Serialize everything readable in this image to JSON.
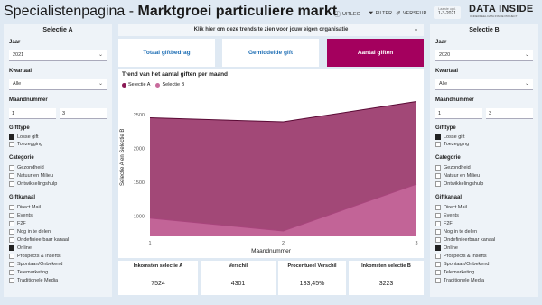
{
  "header": {
    "title_prefix": "Specialistenpagina - ",
    "title_bold": "Marktgroei particuliere markt",
    "buttons": [
      {
        "label": "UITLEG",
        "icon": "info-icon",
        "glyph": "ⓘ"
      },
      {
        "label": "FILTER",
        "icon": "filter-icon",
        "glyph": "⏷"
      },
      {
        "label": "VERSEUR",
        "icon": "eraser-icon",
        "glyph": "✐"
      }
    ],
    "update_label": "Laatste upd.",
    "update_value": "1-3-2021",
    "logo": "DATA INSIDE",
    "logo_sub": "ONDERDEEL DATA INSIDE PROJECT"
  },
  "panel_a": {
    "title": "Selectie A",
    "jaar_label": "Jaar",
    "jaar_value": "2021",
    "kwartaal_label": "Kwartaal",
    "kwartaal_value": "Alle",
    "maand_label": "Maandnummer",
    "maand_from": "1",
    "maand_to": "3",
    "gifttype_label": "Gifttype",
    "gifttype": [
      {
        "label": "Losse gift",
        "checked": true
      },
      {
        "label": "Toezegging",
        "checked": false
      }
    ],
    "categorie_label": "Categorie",
    "categorie": [
      {
        "label": "Gezondheid",
        "checked": false
      },
      {
        "label": "Natuur en Milieu",
        "checked": false
      },
      {
        "label": "Ontwikkelingshulp",
        "checked": false
      }
    ],
    "giftkanaal_label": "Giftkanaal",
    "giftkanaal": [
      {
        "label": "Direct Mail",
        "checked": false
      },
      {
        "label": "Events",
        "checked": false
      },
      {
        "label": "F2F",
        "checked": false
      },
      {
        "label": "Nog in te delen",
        "checked": false
      },
      {
        "label": "Ondefinieerbaar kanaal",
        "checked": false
      },
      {
        "label": "Online",
        "checked": true
      },
      {
        "label": "Prospects & Inserts",
        "checked": false
      },
      {
        "label": "Spontaan/Onbekend",
        "checked": false
      },
      {
        "label": "Telemarketing",
        "checked": false
      },
      {
        "label": "Traditionele Media",
        "checked": false
      }
    ]
  },
  "panel_b": {
    "title": "Selectie B",
    "jaar_label": "Jaar",
    "jaar_value": "2020",
    "kwartaal_label": "Kwartaal",
    "kwartaal_value": "Alle",
    "maand_label": "Maandnummer",
    "maand_from": "1",
    "maand_to": "3",
    "gifttype_label": "Gifttype",
    "gifttype": [
      {
        "label": "Losse gift",
        "checked": true
      },
      {
        "label": "Toezegging",
        "checked": false
      }
    ],
    "categorie_label": "Categorie",
    "categorie": [
      {
        "label": "Gezondheid",
        "checked": false
      },
      {
        "label": "Natuur en Milieu",
        "checked": false
      },
      {
        "label": "Ontwikkelingshulp",
        "checked": false
      }
    ],
    "giftkanaal_label": "Giftkanaal",
    "giftkanaal": [
      {
        "label": "Direct Mail",
        "checked": false
      },
      {
        "label": "Events",
        "checked": false
      },
      {
        "label": "F2F",
        "checked": false
      },
      {
        "label": "Nog in te delen",
        "checked": false
      },
      {
        "label": "Ondefinieerbaar kanaal",
        "checked": false
      },
      {
        "label": "Online",
        "checked": true
      },
      {
        "label": "Prospects & Inserts",
        "checked": false
      },
      {
        "label": "Spontaan/Onbekend",
        "checked": false
      },
      {
        "label": "Telemarketing",
        "checked": false
      },
      {
        "label": "Traditionele Media",
        "checked": false
      }
    ]
  },
  "dropdown_bar": "Klik hier om deze trends te zien voor jouw eigen organisatie",
  "tabs": [
    {
      "label": "Totaal giftbedrag",
      "active": false
    },
    {
      "label": "Gemiddelde gift",
      "active": false
    },
    {
      "label": "Aantal giften",
      "active": true
    }
  ],
  "colors": {
    "accent": "#a4005e",
    "series_a": "#8b1a55",
    "series_b": "#c86a9c"
  },
  "chart_data": {
    "type": "area",
    "title": "Trend van het aantal giften per maand",
    "xlabel": "Maandnummer",
    "ylabel": "Selectie A en Selectie B",
    "x": [
      1,
      2,
      3
    ],
    "series": [
      {
        "name": "Selectie A",
        "values": [
          2450,
          2390,
          2690
        ]
      },
      {
        "name": "Selectie B",
        "values": [
          970,
          780,
          1470
        ]
      }
    ],
    "ylim": [
      700,
      2750
    ],
    "yticks": [
      1000,
      1500,
      2000,
      2500
    ],
    "grid": false,
    "legend": "top-left"
  },
  "kpis": [
    {
      "label": "Inkomsten selectie A",
      "value": "7524"
    },
    {
      "label": "Verschil",
      "value": "4301"
    },
    {
      "label": "Procentueel Verschil",
      "value": "133,45%"
    },
    {
      "label": "Inkomsten selectie B",
      "value": "3223"
    }
  ]
}
